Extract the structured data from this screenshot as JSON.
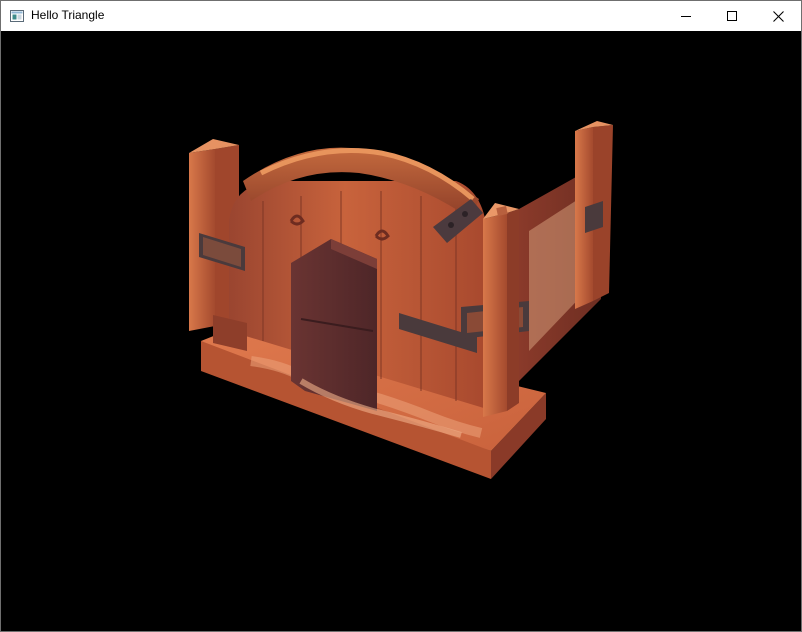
{
  "window": {
    "title": "Hello Triangle"
  },
  "icons": {
    "app": "app-window-icon",
    "minimize": "minimize-icon",
    "maximize": "maximize-icon",
    "close": "close-icon"
  },
  "colors": {
    "titlebar_bg": "#ffffff",
    "viewport_bg": "#000000",
    "wood_main": "#c2603a",
    "wood_dark": "#7a3424",
    "wood_light": "#e08555",
    "door": "#5a2c2c",
    "iron": "#4a3a3c"
  }
}
